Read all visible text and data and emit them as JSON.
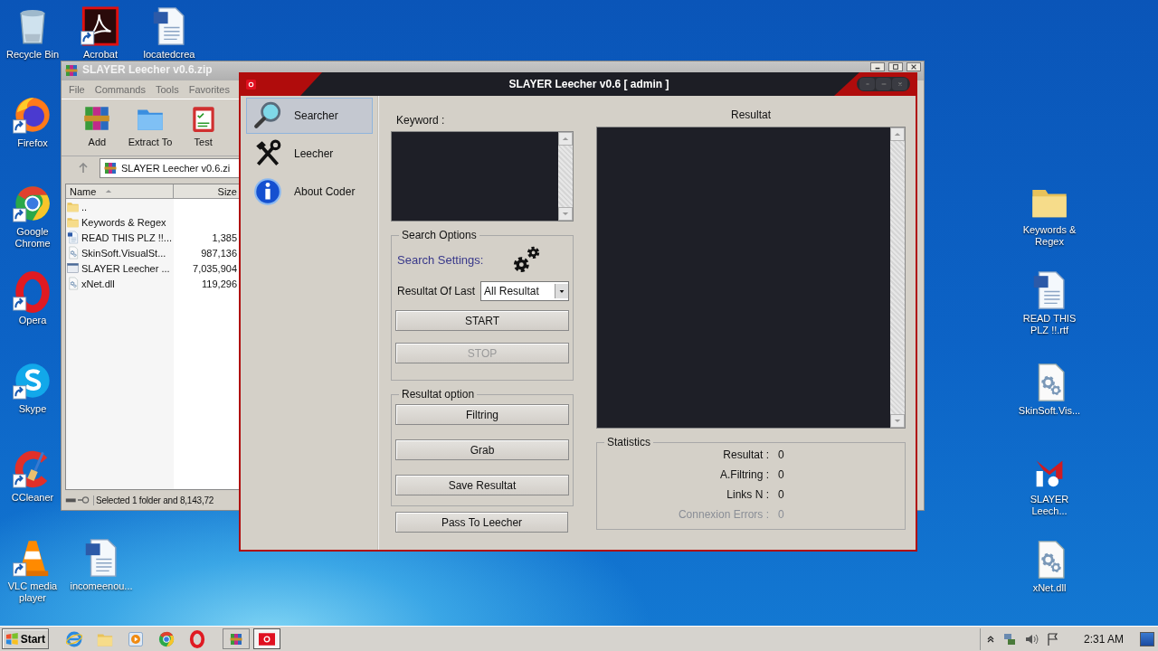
{
  "desktop_icons": [
    {
      "label": "Recycle Bin",
      "kind": "recycle",
      "shortcut": false
    },
    {
      "label": "Acrobat",
      "kind": "acrobat",
      "shortcut": true
    },
    {
      "label": "locatedcrea",
      "kind": "word",
      "shortcut": false
    },
    {
      "label": "Firefox",
      "kind": "firefox",
      "shortcut": true
    },
    {
      "label": "Google Chrome",
      "kind": "chrome",
      "shortcut": true
    },
    {
      "label": "Opera",
      "kind": "opera",
      "shortcut": true
    },
    {
      "label": "Skype",
      "kind": "skype",
      "shortcut": true
    },
    {
      "label": "CCleaner",
      "kind": "ccleaner",
      "shortcut": true
    },
    {
      "label": "VLC media player",
      "kind": "vlc",
      "shortcut": true
    },
    {
      "label": "incomeenou...",
      "kind": "word",
      "shortcut": false
    },
    {
      "label": "Keywords & Regex",
      "kind": "folder",
      "shortcut": false
    },
    {
      "label": "READ THIS PLZ !!.rtf",
      "kind": "word",
      "shortcut": false
    },
    {
      "label": "SkinSoft.Vis...",
      "kind": "dll",
      "shortcut": false
    },
    {
      "label": "SLAYER Leech...",
      "kind": "slayer",
      "shortcut": false
    },
    {
      "label": "xNet.dll",
      "kind": "dll",
      "shortcut": false
    }
  ],
  "archive_window": {
    "title": "SLAYER Leecher v0.6.zip",
    "menu": [
      "File",
      "Commands",
      "Tools",
      "Favorites"
    ],
    "toolbar": [
      {
        "label": "Add",
        "kind": "add"
      },
      {
        "label": "Extract To",
        "kind": "extract"
      },
      {
        "label": "Test",
        "kind": "test"
      }
    ],
    "address": "SLAYER Leecher v0.6.zi",
    "columns": [
      "Name",
      "Size"
    ],
    "rows": [
      {
        "name": "..",
        "size": "",
        "kind": "folder"
      },
      {
        "name": "Keywords & Regex",
        "size": "",
        "kind": "folder"
      },
      {
        "name": "READ THIS PLZ !!...",
        "size": "1,385",
        "kind": "word"
      },
      {
        "name": "SkinSoft.VisualSt...",
        "size": "987,136",
        "kind": "dll"
      },
      {
        "name": "SLAYER Leecher ...",
        "size": "7,035,904",
        "kind": "exe"
      },
      {
        "name": "xNet.dll",
        "size": "119,296",
        "kind": "dll"
      }
    ],
    "status": "Selected 1 folder and 8,143,72"
  },
  "app_window": {
    "title": "SLAYER Leecher v0.6 [ admin ]",
    "nav": [
      {
        "label": "Searcher",
        "kind": "search",
        "selected": true
      },
      {
        "label": "Leecher",
        "kind": "tools",
        "selected": false
      },
      {
        "label": "About Coder",
        "kind": "info",
        "selected": false
      }
    ],
    "keyword_label": "Keyword :",
    "search_options": {
      "title": "Search Options",
      "settings_label": "Search Settings:",
      "last_label": "Resultat Of Last",
      "last_value": "All Resultat",
      "buttons": [
        {
          "label": "START",
          "disabled": false
        },
        {
          "label": "STOP",
          "disabled": true
        }
      ]
    },
    "resultat_option": {
      "title": "Resultat option",
      "buttons": [
        "Filtring",
        "Grab",
        "Save Resultat"
      ]
    },
    "pass_button": "Pass To Leecher",
    "results_label": "Resultat",
    "statistics": {
      "title": "Statistics",
      "rows": [
        {
          "label": "Resultat :",
          "value": "0",
          "disabled": false
        },
        {
          "label": "A.Filtring :",
          "value": "0",
          "disabled": false
        },
        {
          "label": "Links N :",
          "value": "0",
          "disabled": false
        },
        {
          "label": "Connexion Errors :",
          "value": "0",
          "disabled": true
        }
      ]
    }
  },
  "taskbar": {
    "start": "Start",
    "quick_launch": [
      {
        "kind": "ie"
      },
      {
        "kind": "explorer"
      },
      {
        "kind": "media"
      },
      {
        "kind": "chrome"
      },
      {
        "kind": "opera"
      }
    ],
    "windows": [
      {
        "kind": "add",
        "selected": false
      },
      {
        "kind": "slayer",
        "selected": true
      }
    ],
    "clock": "2:31 AM"
  }
}
